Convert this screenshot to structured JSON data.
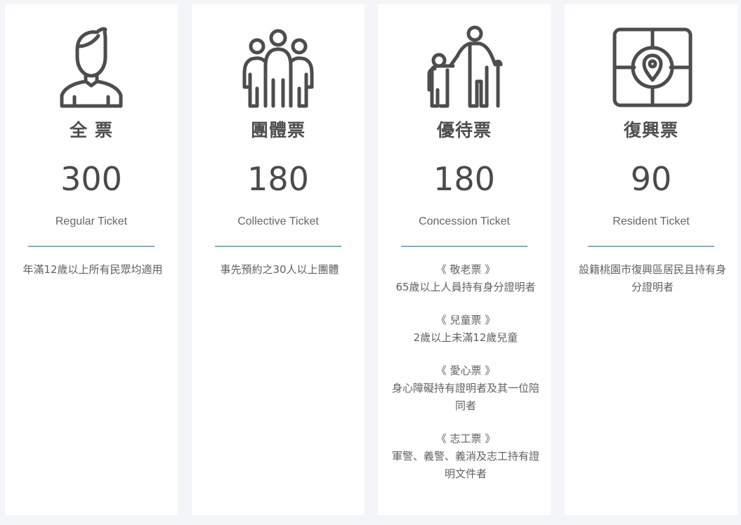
{
  "cards": [
    {
      "icon": "person-icon",
      "title": "全 票",
      "price": "300",
      "subtitle": "Regular Ticket",
      "desc": "年滿12歲以上所有民眾均適用"
    },
    {
      "icon": "group-icon",
      "title": "團體票",
      "price": "180",
      "subtitle": "Collective Ticket",
      "desc": "事先預約之30人以上團體"
    },
    {
      "icon": "elder-child-icon",
      "title": "優待票",
      "price": "180",
      "subtitle": "Concession Ticket",
      "blocks": [
        {
          "head": "《 敬老票 》",
          "lines": [
            "65歲以上人員持有身分證明者"
          ]
        },
        {
          "head": "《 兒童票 》",
          "lines": [
            "2歲以上未滿12歲兒童"
          ]
        },
        {
          "head": "《 愛心票 》",
          "lines": [
            "身心障礙持有證明者及其一位陪",
            "同者"
          ]
        },
        {
          "head": "《 志工票 》",
          "lines": [
            "軍警、義警、義消及志工持有證",
            "明文件者"
          ]
        }
      ]
    },
    {
      "icon": "map-pin-icon",
      "title": "復興票",
      "price": "90",
      "subtitle": "Resident Ticket",
      "desc_lines": [
        "設籍桃園市復興區居民且持有身",
        "分證明者"
      ]
    }
  ],
  "colors": {
    "background": "#f4f5f9",
    "card": "#ffffff",
    "divider": "#84aec0",
    "icon": "#4d4d4d"
  }
}
